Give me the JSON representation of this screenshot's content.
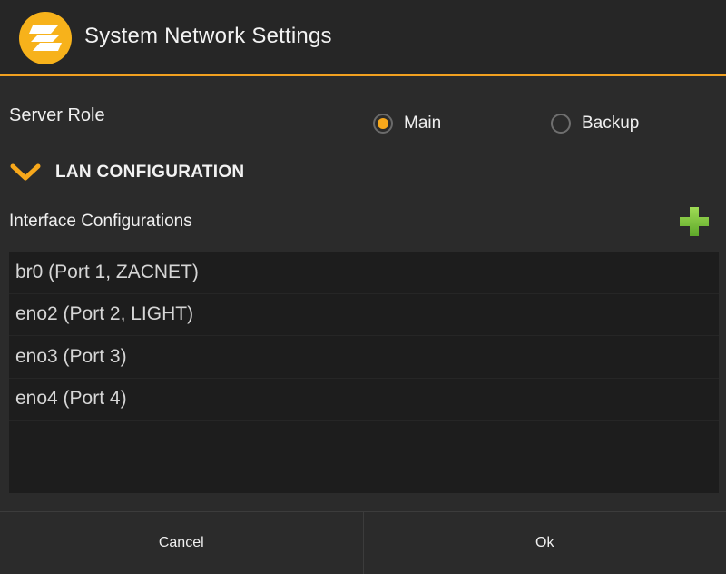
{
  "header": {
    "title": "System Network Settings",
    "logo_icon": "zone-logo-icon",
    "accent_color": "#f0a020"
  },
  "server_role": {
    "label": "Server Role",
    "options": [
      {
        "label": "Main",
        "selected": true
      },
      {
        "label": "Backup",
        "selected": false
      }
    ]
  },
  "lan": {
    "section_title": "LAN CONFIGURATION",
    "expanded": true,
    "interfaces_label": "Interface Configurations",
    "interfaces": [
      {
        "label": "br0 (Port 1, ZACNET)"
      },
      {
        "label": "eno2 (Port 2, LIGHT)"
      },
      {
        "label": "eno3 (Port 3)"
      },
      {
        "label": "eno4 (Port 4)"
      }
    ]
  },
  "footer": {
    "cancel_label": "Cancel",
    "ok_label": "Ok"
  }
}
